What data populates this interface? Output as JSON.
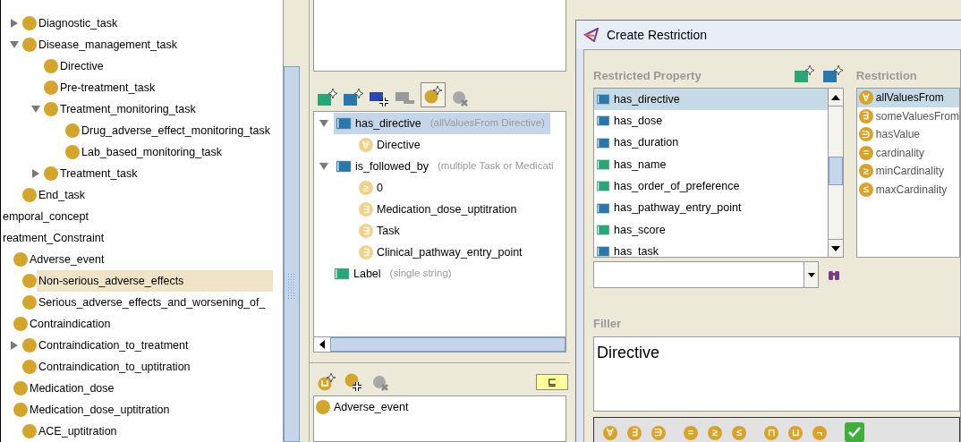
{
  "class_tree": {
    "cut_branch": [
      {
        "label": "Diagnostic_task",
        "expanded": false,
        "selected": false
      },
      {
        "label": "Disease_management_task",
        "expanded": true,
        "selected": false,
        "children": [
          {
            "label": "Directive",
            "selected": false
          },
          {
            "label": "Pre-treatment_task",
            "selected": false
          },
          {
            "label": "Treatment_monitoring_task",
            "expanded": true,
            "selected": false,
            "children": [
              {
                "label": "Drug_adverse_effect_monitoring_task",
                "selected": false
              },
              {
                "label": "Lab_based_monitoring_task",
                "selected": false
              }
            ]
          },
          {
            "label": "Treatment_task",
            "expanded": false,
            "selected": false
          }
        ]
      },
      {
        "label": "End_task",
        "selected": false
      }
    ],
    "roots": [
      {
        "label": "emporal_concept",
        "selected": false
      },
      {
        "label": "reatment_Constraint",
        "selected": false,
        "children": [
          {
            "label": "Adverse_event",
            "selected": false,
            "children": [
              {
                "label": "Non-serious_adverse_effects",
                "selected": true
              },
              {
                "label": "Serious_adverse_effects_and_worsening_of_",
                "selected": false
              }
            ]
          },
          {
            "label": "Contraindication",
            "selected": false,
            "children": [
              {
                "label": "Contraindication_to_treatment",
                "expanded": false,
                "selected": false
              },
              {
                "label": "Contraindication_to_uptitration",
                "selected": false
              }
            ]
          },
          {
            "label": "Medication_dose",
            "selected": false
          },
          {
            "label": "Medication_dose_uptitration",
            "selected": false,
            "children": [
              {
                "label": "ACE_uptitration",
                "selected": false
              }
            ]
          }
        ]
      }
    ]
  },
  "properties_panel": {
    "rows": [
      {
        "kind": "object",
        "name": "has_directive",
        "note": "(allValuesFrom Directive)",
        "expanded": true,
        "selected": true,
        "children": [
          {
            "symbol": "∀",
            "label": "Directive"
          }
        ]
      },
      {
        "kind": "object",
        "name": "is_followed_by",
        "note": "(multiple Task or Medicati",
        "expanded": true,
        "selected": false,
        "children": [
          {
            "symbol": "≥",
            "label": "0"
          },
          {
            "symbol": "∃",
            "label": "Medication_dose_uptitration"
          },
          {
            "symbol": "∃",
            "label": "Task"
          },
          {
            "symbol": "∃",
            "label": "Clinical_pathway_entry_point"
          }
        ]
      },
      {
        "kind": "datatype",
        "name": "Label",
        "note": "(single string)",
        "selected": false,
        "children": []
      }
    ],
    "subsumption_button": "⊑",
    "superclasses": [
      "Adverse_event"
    ]
  },
  "dialog": {
    "title": "Create Restriction",
    "property_heading": "Restricted Property",
    "properties": [
      {
        "kind": "object",
        "name": "has_directive",
        "selected": true
      },
      {
        "kind": "object",
        "name": "has_dose",
        "selected": false
      },
      {
        "kind": "object",
        "name": "has_duration",
        "selected": false
      },
      {
        "kind": "datatype",
        "name": "has_name",
        "selected": false
      },
      {
        "kind": "datatype",
        "name": "has_order_of_preference",
        "selected": false
      },
      {
        "kind": "object",
        "name": "has_pathway_entry_point",
        "selected": false
      },
      {
        "kind": "datatype",
        "name": "has_score",
        "selected": false
      },
      {
        "kind": "object",
        "name": "has_task",
        "selected": false
      }
    ],
    "restriction_heading": "Restriction",
    "restrictions": [
      {
        "symbol": "∀",
        "label": "allValuesFrom",
        "selected": true
      },
      {
        "symbol": "∃",
        "label": "someValuesFrom",
        "selected": false
      },
      {
        "symbol": "∋",
        "label": "hasValue",
        "selected": false
      },
      {
        "symbol": "=",
        "label": "cardinality",
        "selected": false
      },
      {
        "symbol": "≥",
        "label": "minCardinality",
        "selected": false
      },
      {
        "symbol": "≤",
        "label": "maxCardinality",
        "selected": false
      }
    ],
    "filler_heading": "Filler",
    "filler": "Directive",
    "operator_groups": [
      [
        "∀",
        "∃",
        "∋"
      ],
      [
        "=",
        "≥",
        "≤"
      ],
      [
        "⊓",
        "⊔",
        "¬"
      ]
    ]
  }
}
